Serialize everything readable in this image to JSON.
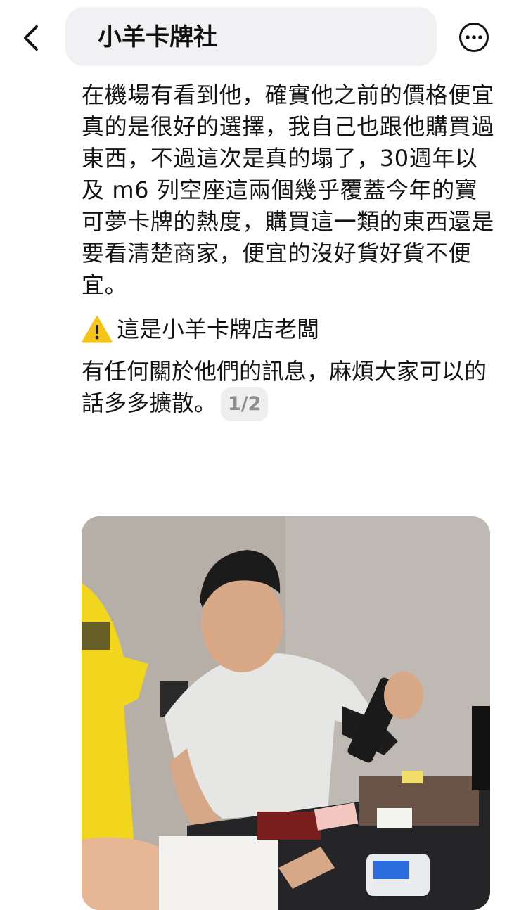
{
  "header": {
    "title": "小羊卡牌社",
    "back_icon": "chevron-left-icon",
    "more_icon": "more-options-icon"
  },
  "post": {
    "paragraph1": "在機場有看到他，確實他之前的價格便宜真的是很好的選擇，我自己也跟他購買過東西，不過這次是真的塌了，30週年以及 m6 列空座這兩個幾乎覆蓋今年的寶可夢卡牌的熱度，購買這一類的東西還是要看清楚商家，便宜的沒好貨好貨不便宜。",
    "warning_icon": "warning-icon",
    "warning_text": "這是小羊卡牌店老闆",
    "paragraph3": "有任何關於他們的訊息，麻煩大家可以的話多多擴散。",
    "page_indicator": "1/2"
  },
  "colors": {
    "title_pill_bg": "#f1f1f3",
    "warning_yellow": "#f6c417",
    "badge_bg": "#eeeeee",
    "badge_text": "#8c8c8c"
  }
}
